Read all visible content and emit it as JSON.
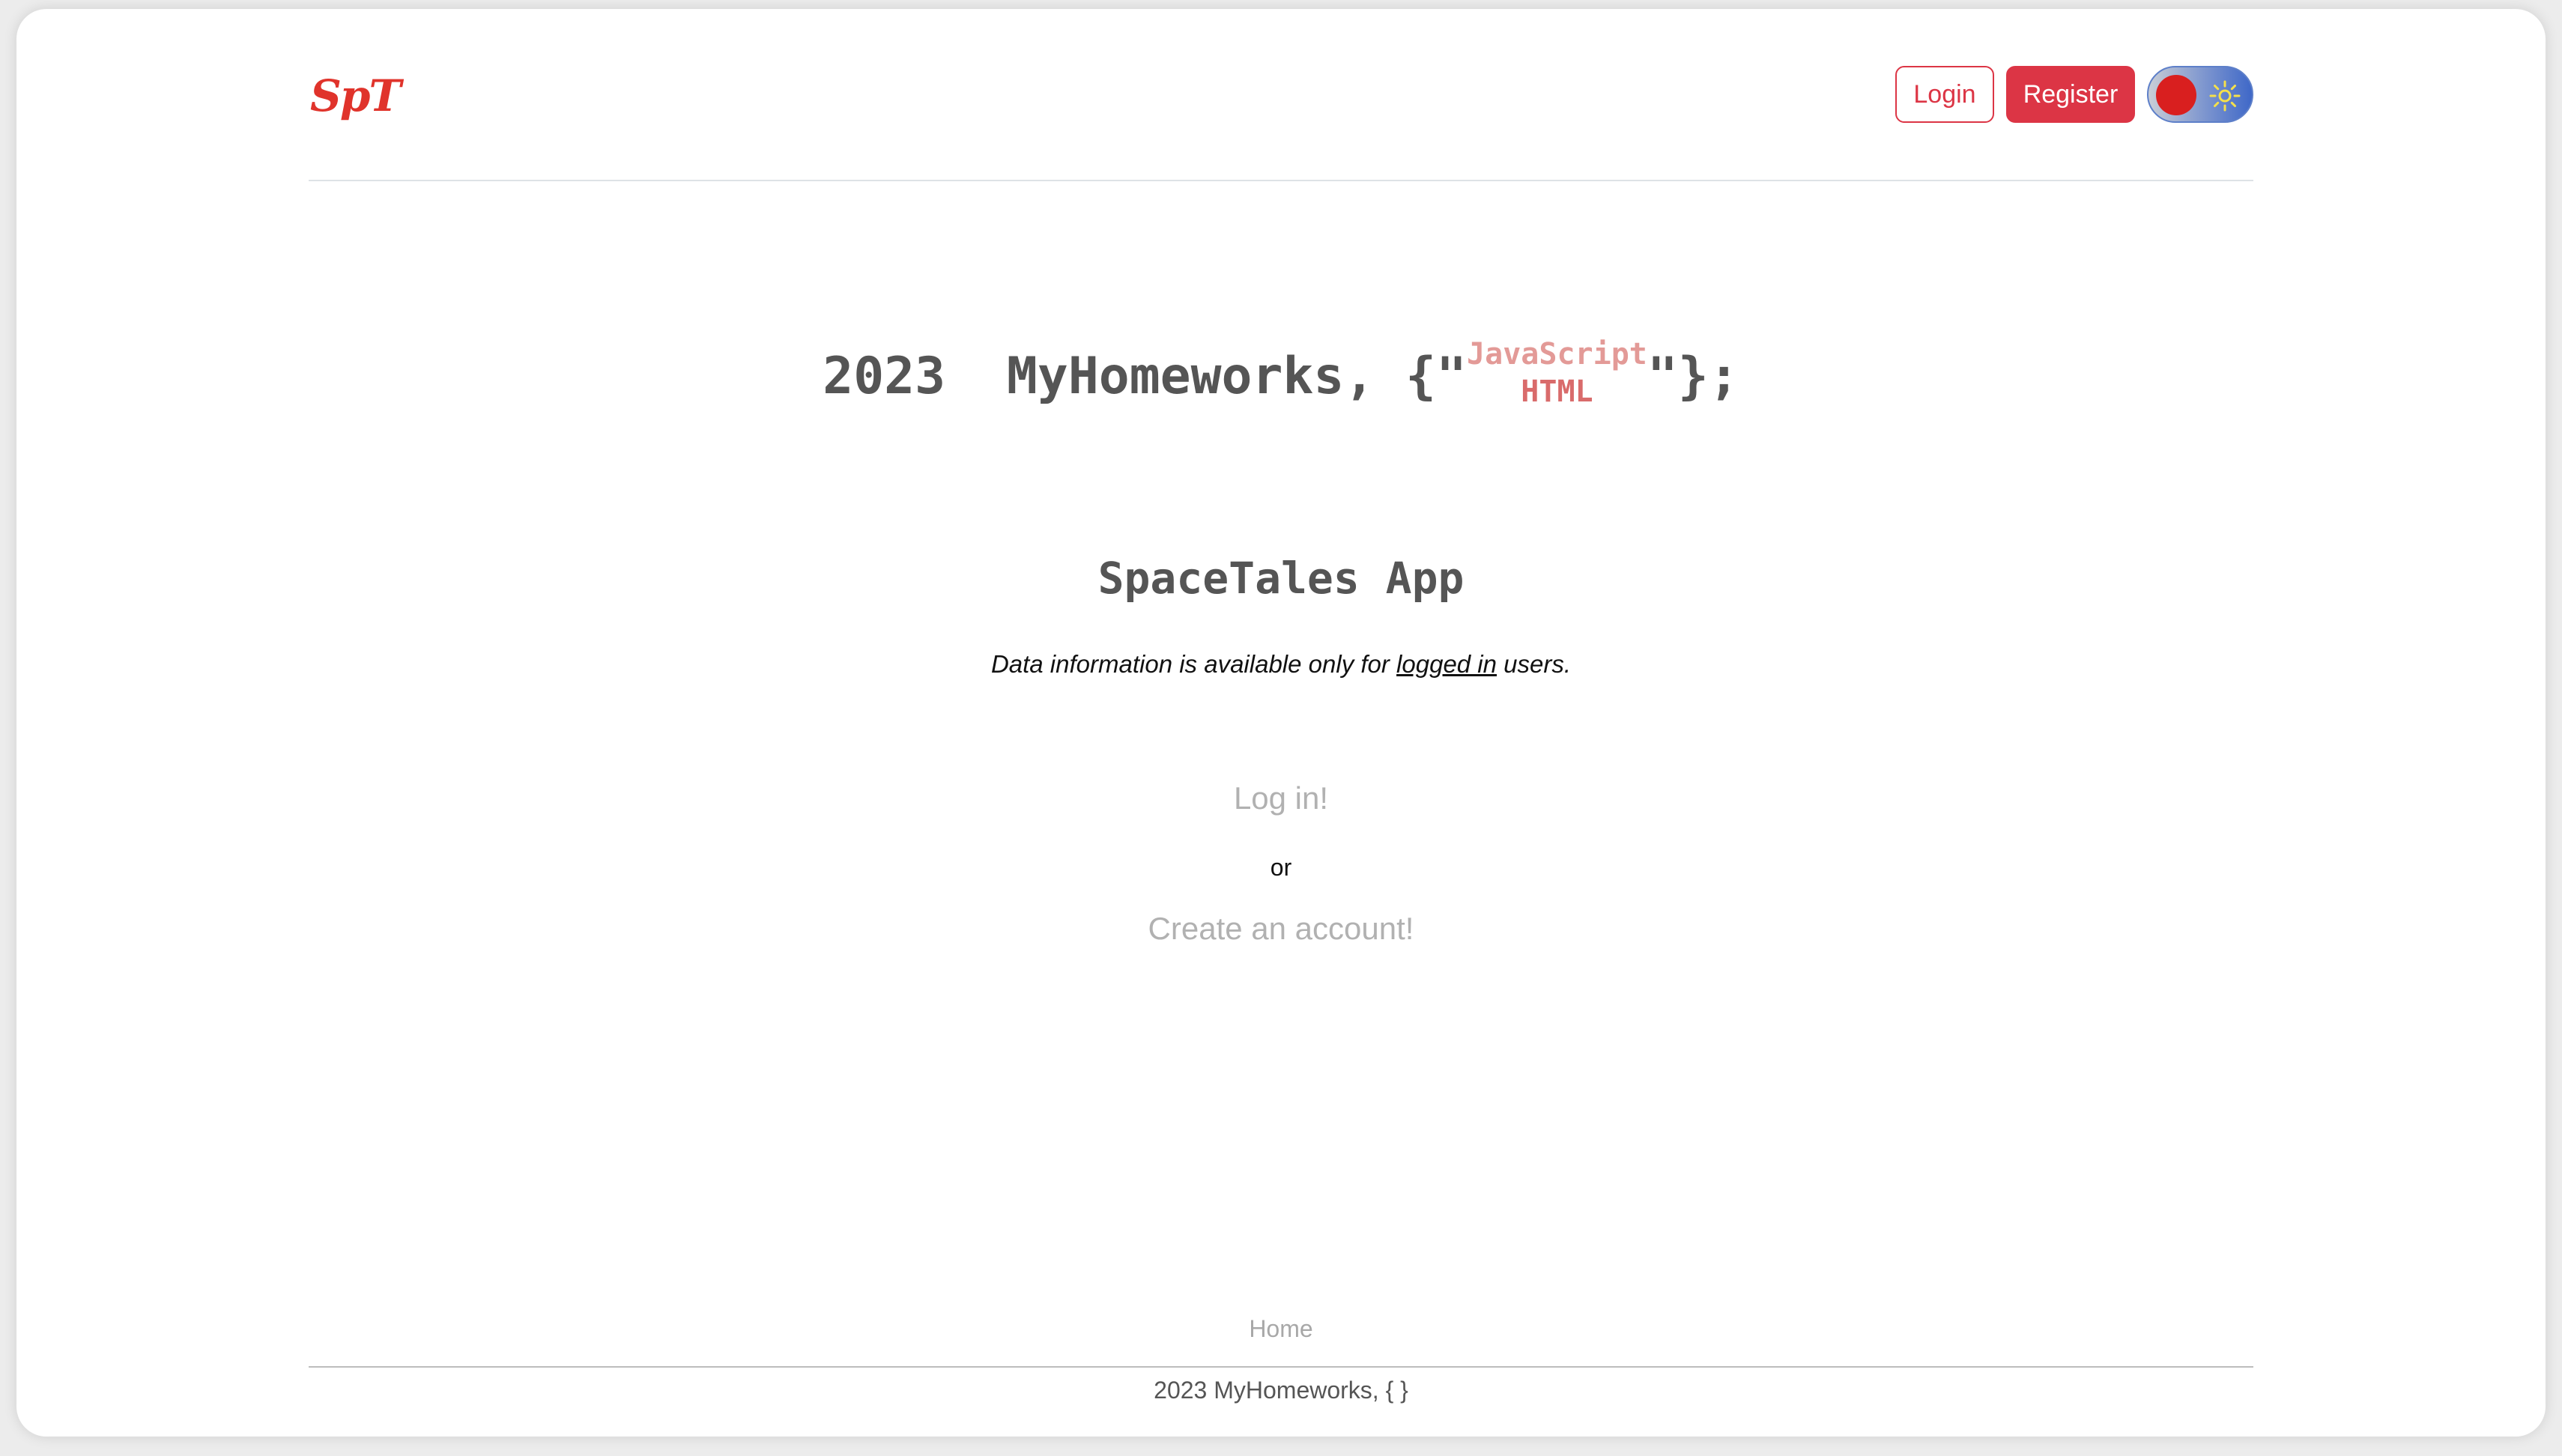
{
  "header": {
    "logo": "SpT",
    "login_label": "Login",
    "register_label": "Register",
    "theme_toggle": {
      "knob_color": "#d91f1f",
      "icon": "sun-icon",
      "icon_color": "#f5e04a"
    }
  },
  "hero": {
    "prefix": "2023  MyHomeworks, {\"",
    "rotating_words": [
      "JavaScript",
      "HTML"
    ],
    "suffix": "\"};"
  },
  "main": {
    "title": "SpaceTales App",
    "info_before": "Data information is available only for ",
    "info_link": "logged in",
    "info_after": " users.",
    "login_link": "Log in!",
    "or_text": "or",
    "register_link": "Create an account!"
  },
  "footer": {
    "nav_home": "Home",
    "copyright": "2023 MyHomeworks, { }"
  },
  "colors": {
    "accent": "#dc3545",
    "logo": "#e0332b",
    "muted_link": "#b1b1b1",
    "heading": "#555555"
  }
}
